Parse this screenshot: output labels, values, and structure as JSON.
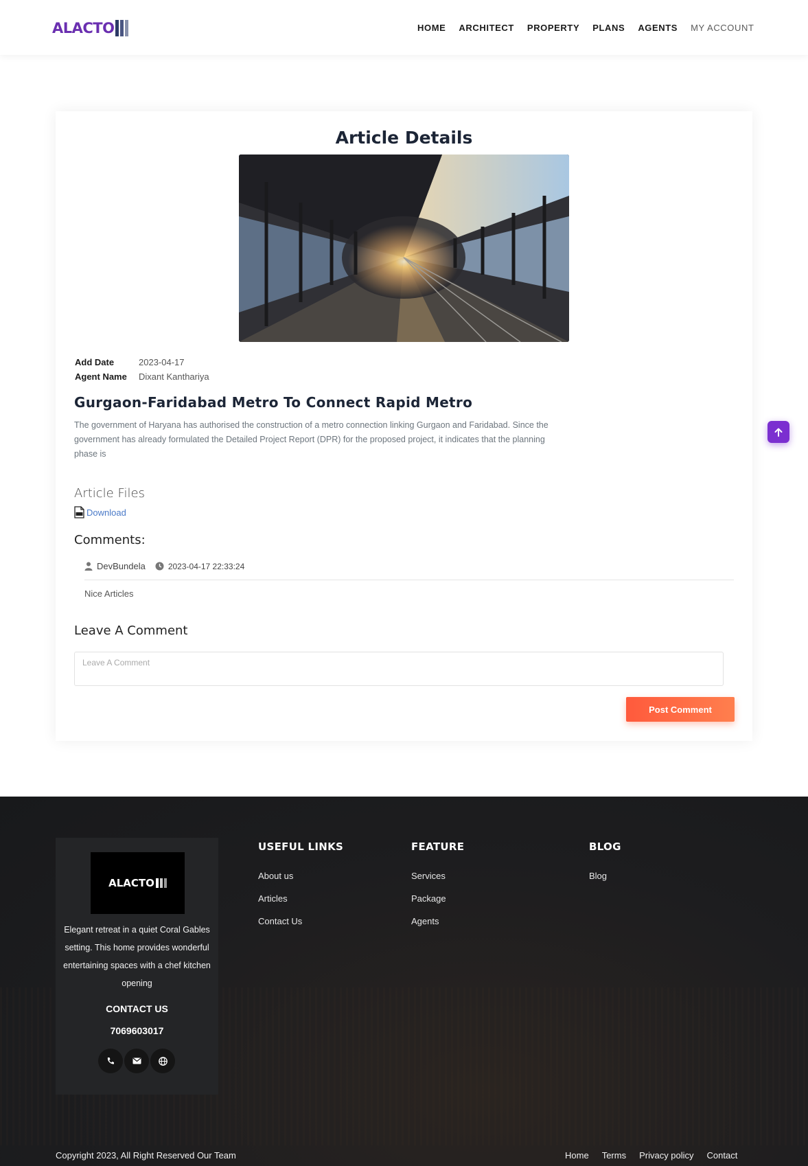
{
  "header": {
    "logo_text": "ALACTO",
    "nav": [
      {
        "label": "HOME"
      },
      {
        "label": "ARCHITECT"
      },
      {
        "label": "PROPERTY"
      },
      {
        "label": "PLANS"
      },
      {
        "label": "AGENTS"
      },
      {
        "label": "MY ACCOUNT"
      }
    ]
  },
  "article": {
    "page_title": "Article Details",
    "add_date_label": "Add Date",
    "add_date": "2023-04-17",
    "agent_label": "Agent Name",
    "agent_name": "Dixant Kanthariya",
    "title": "Gurgaon-Faridabad Metro To Connect Rapid Metro",
    "body": "The government of Haryana has authorised the construction of a metro connection linking Gurgaon and Faridabad. Since the government has already formulated the Detailed Project Report (DPR) for the proposed project, it indicates that the planning phase is",
    "files_title": "Article Files",
    "download_label": "Download"
  },
  "comments": {
    "title": "Comments:",
    "items": [
      {
        "user": "DevBundela",
        "datetime": "2023-04-17 22:33:24",
        "text": "Nice Articles"
      }
    ],
    "leave_title": "Leave A Comment",
    "placeholder": "Leave A Comment",
    "post_label": "Post Comment"
  },
  "footer": {
    "logo_text": "ALACTO",
    "about": "Elegant retreat in a quiet Coral Gables setting. This home provides wonderful entertaining spaces with a chef kitchen opening",
    "contact_label": "CONTACT US",
    "phone": "7069603017",
    "useful_links": {
      "title": "USEFUL LINKS",
      "items": [
        "About us",
        "Articles",
        "Contact Us"
      ]
    },
    "feature": {
      "title": "FEATURE",
      "items": [
        "Services",
        "Package",
        "Agents"
      ]
    },
    "blog": {
      "title": "BLOG",
      "items": [
        "Blog"
      ]
    },
    "copyright": "Copyright 2023, All Right Reserved Our Team",
    "bottom_links": [
      "Home",
      "Terms",
      "Privacy policy",
      "Contact"
    ]
  },
  "colors": {
    "brand": "#6a2fb0",
    "accent": "#ff6b45",
    "scroll_button": "#7b2fd0"
  },
  "icons": [
    "user-icon",
    "clock-icon",
    "pdf-file-icon",
    "arrow-up-icon",
    "phone-icon",
    "envelope-icon",
    "globe-icon"
  ]
}
